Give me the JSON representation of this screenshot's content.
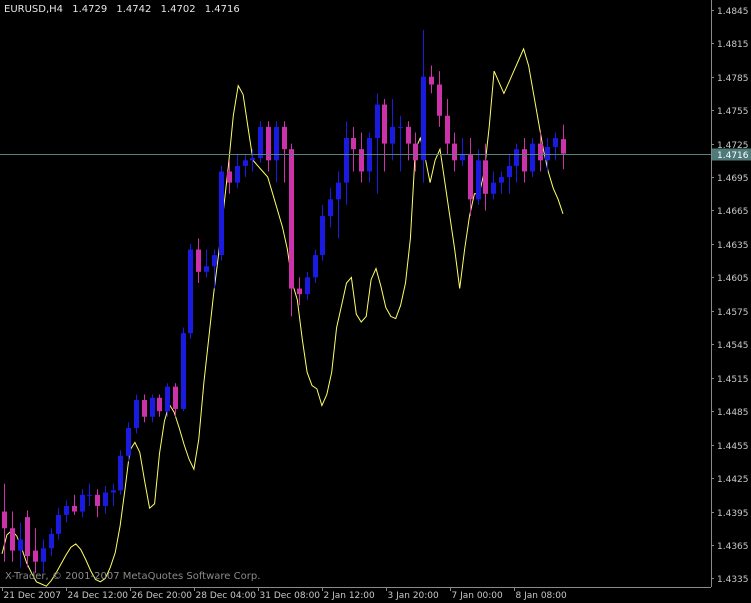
{
  "header": {
    "symbol": "EURUSD,H4",
    "open": "1.4729",
    "high": "1.4742",
    "low": "1.4702",
    "close": "1.4716"
  },
  "footer": {
    "copyright": "X-Trader, © 2001-2007 MetaQuotes Software Corp."
  },
  "colors": {
    "background": "#000000",
    "bull": "#1a1ae0",
    "bear": "#cc33aa",
    "indicator": "#ffff66",
    "price_line": "#5a7f7f",
    "price_badge": "#4f7a7a",
    "axis": "#8a8a8a"
  },
  "chart_data": {
    "type": "candlestick",
    "ylim": [
      1.433,
      1.4852
    ],
    "y_ticks": [
      "1.4845",
      "1.4815",
      "1.4785",
      "1.4755",
      "1.4725",
      "1.4695",
      "1.4665",
      "1.4635",
      "1.4605",
      "1.4575",
      "1.4545",
      "1.4515",
      "1.4485",
      "1.4455",
      "1.4425",
      "1.4395",
      "1.4365",
      "1.4335"
    ],
    "current_price": "1.4716",
    "x_labels": [
      "21 Dec 2007",
      "24 Dec 12:00",
      "26 Dec 20:00",
      "28 Dec 04:00",
      "31 Dec 08:00",
      "2 Jan 12:00",
      "3 Jan 20:00",
      "7 Jan 00:00",
      "8 Jan 08:00"
    ],
    "candles": [
      [
        1.4395,
        1.442,
        1.435,
        1.438
      ],
      [
        1.438,
        1.4395,
        1.435,
        1.436
      ],
      [
        1.436,
        1.4385,
        1.4345,
        1.437
      ],
      [
        1.439,
        1.4396,
        1.4345,
        1.4355
      ],
      [
        1.436,
        1.438,
        1.434,
        1.435
      ],
      [
        1.435,
        1.437,
        1.434,
        1.4362
      ],
      [
        1.4362,
        1.438,
        1.4355,
        1.4375
      ],
      [
        1.4375,
        1.4398,
        1.437,
        1.4392
      ],
      [
        1.4392,
        1.4405,
        1.4385,
        1.44
      ],
      [
        1.44,
        1.441,
        1.4392,
        1.4395
      ],
      [
        1.4395,
        1.4415,
        1.439,
        1.441
      ],
      [
        1.441,
        1.442,
        1.44,
        1.441
      ],
      [
        1.441,
        1.4415,
        1.439,
        1.44
      ],
      [
        1.44,
        1.4418,
        1.4393,
        1.4412
      ],
      [
        1.4412,
        1.442,
        1.44,
        1.4414
      ],
      [
        1.4414,
        1.445,
        1.441,
        1.4445
      ],
      [
        1.4445,
        1.4475,
        1.444,
        1.447
      ],
      [
        1.447,
        1.45,
        1.4465,
        1.4495
      ],
      [
        1.4495,
        1.45,
        1.4475,
        1.448
      ],
      [
        1.448,
        1.45,
        1.4475,
        1.4497
      ],
      [
        1.4497,
        1.45,
        1.448,
        1.4485
      ],
      [
        1.4485,
        1.451,
        1.448,
        1.4507
      ],
      [
        1.4507,
        1.451,
        1.448,
        1.4487
      ],
      [
        1.4487,
        1.456,
        1.4485,
        1.4555
      ],
      [
        1.4555,
        1.4635,
        1.455,
        1.463
      ],
      [
        1.463,
        1.464,
        1.46,
        1.461
      ],
      [
        1.461,
        1.463,
        1.4605,
        1.4615
      ],
      [
        1.4615,
        1.463,
        1.4595,
        1.4625
      ],
      [
        1.4625,
        1.4705,
        1.462,
        1.47
      ],
      [
        1.47,
        1.471,
        1.468,
        1.469
      ],
      [
        1.469,
        1.4715,
        1.4685,
        1.4705
      ],
      [
        1.4705,
        1.4715,
        1.4695,
        1.471
      ],
      [
        1.471,
        1.472,
        1.47,
        1.4712
      ],
      [
        1.4712,
        1.4745,
        1.4708,
        1.474
      ],
      [
        1.474,
        1.4745,
        1.47,
        1.471
      ],
      [
        1.471,
        1.4745,
        1.469,
        1.474
      ],
      [
        1.474,
        1.4745,
        1.469,
        1.472
      ],
      [
        1.472,
        1.4725,
        1.457,
        1.4595
      ],
      [
        1.4595,
        1.4605,
        1.458,
        1.459
      ],
      [
        1.459,
        1.461,
        1.4585,
        1.4605
      ],
      [
        1.4605,
        1.463,
        1.46,
        1.4625
      ],
      [
        1.4625,
        1.467,
        1.462,
        1.466
      ],
      [
        1.466,
        1.4685,
        1.465,
        1.4675
      ],
      [
        1.4675,
        1.47,
        1.464,
        1.469
      ],
      [
        1.469,
        1.4745,
        1.467,
        1.473
      ],
      [
        1.473,
        1.474,
        1.47,
        1.472
      ],
      [
        1.472,
        1.4735,
        1.469,
        1.47
      ],
      [
        1.47,
        1.4735,
        1.469,
        1.473
      ],
      [
        1.473,
        1.477,
        1.468,
        1.476
      ],
      [
        1.476,
        1.4765,
        1.47,
        1.4725
      ],
      [
        1.4725,
        1.4765,
        1.471,
        1.474
      ],
      [
        1.474,
        1.475,
        1.47,
        1.474
      ],
      [
        1.474,
        1.4745,
        1.471,
        1.4725
      ],
      [
        1.4725,
        1.4735,
        1.47,
        1.471
      ],
      [
        1.471,
        1.4827,
        1.469,
        1.4785
      ],
      [
        1.4785,
        1.4795,
        1.477,
        1.4778
      ],
      [
        1.4778,
        1.479,
        1.474,
        1.475
      ],
      [
        1.475,
        1.4765,
        1.4715,
        1.4725
      ],
      [
        1.4725,
        1.4735,
        1.47,
        1.471
      ],
      [
        1.471,
        1.473,
        1.4705,
        1.4715
      ],
      [
        1.4715,
        1.473,
        1.466,
        1.4675
      ],
      [
        1.4675,
        1.472,
        1.467,
        1.471
      ],
      [
        1.471,
        1.4725,
        1.4665,
        1.468
      ],
      [
        1.468,
        1.47,
        1.4675,
        1.469
      ],
      [
        1.469,
        1.47,
        1.468,
        1.4695
      ],
      [
        1.4695,
        1.4715,
        1.468,
        1.4705
      ],
      [
        1.4705,
        1.4725,
        1.469,
        1.472
      ],
      [
        1.472,
        1.473,
        1.469,
        1.47
      ],
      [
        1.47,
        1.473,
        1.4695,
        1.4725
      ],
      [
        1.4725,
        1.4735,
        1.47,
        1.471
      ],
      [
        1.471,
        1.473,
        1.47,
        1.4722
      ],
      [
        1.4722,
        1.4735,
        1.471,
        1.473
      ],
      [
        1.4729,
        1.4742,
        1.4702,
        1.4716
      ]
    ],
    "indicator": [
      1.4357,
      1.4374,
      1.4378,
      1.4373,
      1.4362,
      1.4349,
      1.434,
      1.4332,
      1.433,
      1.4328,
      1.4333,
      1.434,
      1.4348,
      1.4356,
      1.4363,
      1.4366,
      1.4361,
      1.4352,
      1.4342,
      1.4334,
      1.4332,
      1.4335,
      1.4345,
      1.4358,
      1.4382,
      1.4415,
      1.445,
      1.4457,
      1.4448,
      1.4422,
      1.4398,
      1.4402,
      1.4447,
      1.4476,
      1.4491,
      1.4484,
      1.447,
      1.4455,
      1.4442,
      1.4433,
      1.446,
      1.451,
      1.455,
      1.459,
      1.4625,
      1.4665,
      1.4705,
      1.475,
      1.4777,
      1.4769,
      1.4739,
      1.471,
      1.4705,
      1.47,
      1.4695,
      1.468,
      1.4665,
      1.465,
      1.463,
      1.46,
      1.4585,
      1.455,
      1.452,
      1.4508,
      1.4505,
      1.449,
      1.45,
      1.452,
      1.456,
      1.458,
      1.46,
      1.4605,
      1.4572,
      1.4565,
      1.457,
      1.4603,
      1.4613,
      1.4597,
      1.4578,
      1.457,
      1.4568,
      1.458,
      1.46,
      1.464,
      1.472,
      1.473,
      1.4712,
      1.469,
      1.471,
      1.472,
      1.469,
      1.466,
      1.463,
      1.4595,
      1.463,
      1.466,
      1.468,
      1.468,
      1.47,
      1.474,
      1.479,
      1.478,
      1.477,
      1.478,
      1.479,
      1.48,
      1.481,
      1.4795,
      1.477,
      1.4745,
      1.472,
      1.47,
      1.4685,
      1.4675,
      1.4662
    ]
  }
}
